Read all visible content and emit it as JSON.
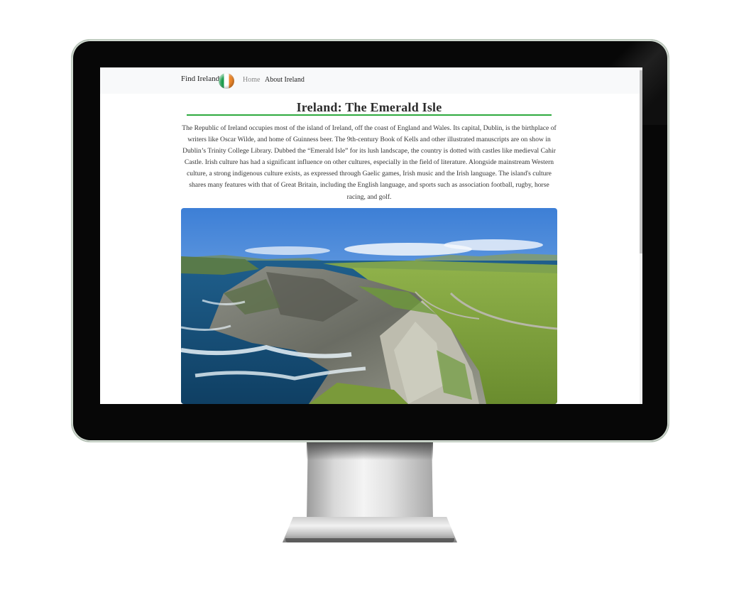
{
  "navbar": {
    "brand": "Find Ireland",
    "links": [
      "Home",
      "About Ireland"
    ]
  },
  "content": {
    "title": "Ireland: The Emerald Isle",
    "paragraph": "The Republic of Ireland occupies most of the island of Ireland, off the coast of England and Wales. Its capital, Dublin, is the birthplace of writers like Oscar Wilde, and home of Guinness beer. The 9th-century Book of Kells and other illustrated manuscripts are on show in Dublin’s Trinity College Library. Dubbed the “Emerald Isle” for its lush landscape, the country is dotted with castles like medieval Cahir Castle. Irish culture has had a significant influence on other cultures, especially in the field of literature. Alongside mainstream Western culture, a strong indigenous culture exists, as expressed through Gaelic games, Irish music and the Irish language. The island's culture shares many features with that of Great Britain, including the English language, and sports such as association football, rugby, horse racing, and golf."
  },
  "colors": {
    "accent_green": "#2eaa3f",
    "navbar_bg": "#f8f9fa",
    "flag_green": "#1a9b4b",
    "flag_orange": "#f0892b"
  }
}
